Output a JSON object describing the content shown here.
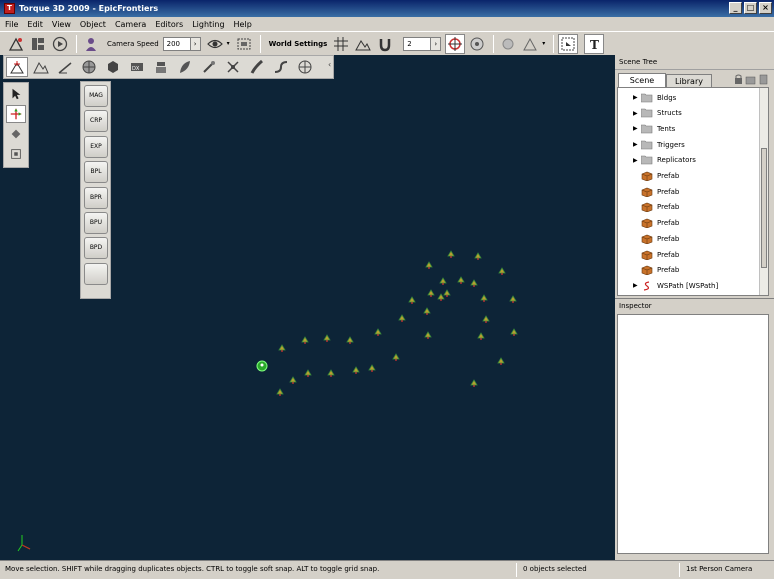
{
  "window": {
    "title": "Torque 3D 2009 - EpicFrontiers",
    "app_icon": "torque-icon"
  },
  "menu": [
    "File",
    "Edit",
    "View",
    "Object",
    "Camera",
    "Editors",
    "Lighting",
    "Help"
  ],
  "toolbar": {
    "camera_speed_label": "Camera Speed",
    "camera_speed_value": "200",
    "world_settings_label": "World Settings",
    "snap_value": "2"
  },
  "dropdown_buttons": [
    "MAG",
    "CRP",
    "EXP",
    "BPL",
    "BPR",
    "BPU",
    "BPD",
    ""
  ],
  "scene_tree": {
    "header": "Scene Tree",
    "tabs": [
      "Scene",
      "Library"
    ],
    "items": [
      {
        "label": "Bldgs",
        "icon": "folder-icon"
      },
      {
        "label": "Structs",
        "icon": "folder-icon"
      },
      {
        "label": "Tents",
        "icon": "folder-icon"
      },
      {
        "label": "Triggers",
        "icon": "folder-icon"
      },
      {
        "label": "Replicators",
        "icon": "folder-icon"
      },
      {
        "label": "Prefab",
        "icon": "prefab-icon"
      },
      {
        "label": "Prefab",
        "icon": "prefab-icon"
      },
      {
        "label": "Prefab",
        "icon": "prefab-icon"
      },
      {
        "label": "Prefab",
        "icon": "prefab-icon"
      },
      {
        "label": "Prefab",
        "icon": "prefab-icon"
      },
      {
        "label": "Prefab",
        "icon": "prefab-icon"
      },
      {
        "label": "Prefab",
        "icon": "prefab-icon"
      },
      {
        "label": "WSPath [WSPath]",
        "icon": "path-icon"
      }
    ]
  },
  "inspector": {
    "header": "Inspector"
  },
  "status": {
    "hint": "Move selection.  SHIFT while dragging duplicates objects.  CTRL to toggle soft snap.  ALT to toggle grid snap.",
    "selection": "0 objects selected",
    "camera": "1st Person Camera"
  },
  "colors": {
    "viewport": "#0d2437",
    "titlebar": "#0a246a",
    "panel": "#d4d0c8"
  }
}
